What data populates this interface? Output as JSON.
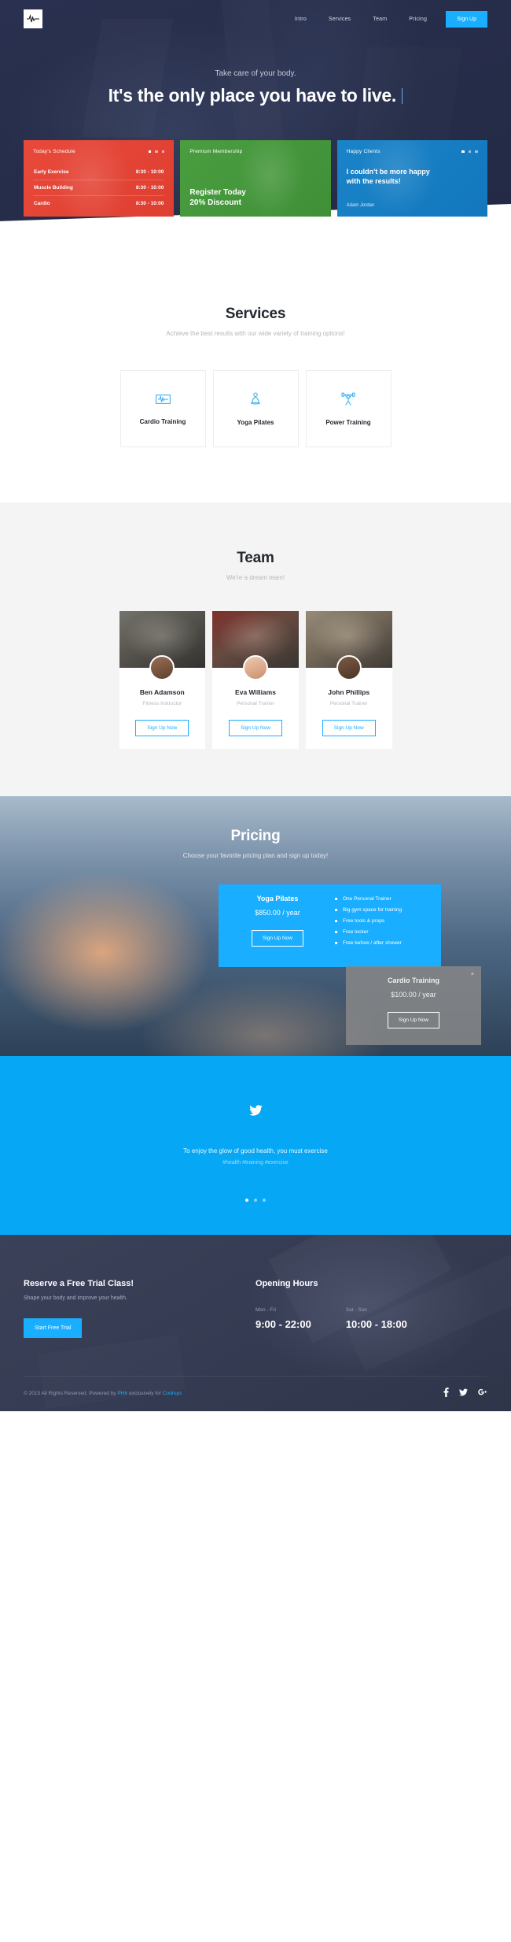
{
  "nav": {
    "logo_icon": "heartbeat-logo-icon",
    "links": [
      {
        "label": "Intro"
      },
      {
        "label": "Services"
      },
      {
        "label": "Team"
      },
      {
        "label": "Pricing"
      }
    ],
    "signup_label": "Sign Up"
  },
  "hero": {
    "subtitle": "Take care of your body.",
    "title": "It's the only place you have to live."
  },
  "promos": {
    "schedule": {
      "heading": "Today's Schedule",
      "rows": [
        {
          "name": "Early Exercise",
          "time": "8:30 - 10:00"
        },
        {
          "name": "Muscle Building",
          "time": "8:30 - 10:00"
        },
        {
          "name": "Cardio",
          "time": "8:30 - 10:00"
        }
      ]
    },
    "membership": {
      "heading": "Premium Membership",
      "line1": "Register Today",
      "line2": "20% Discount"
    },
    "clients": {
      "heading": "Happy Clients",
      "quote_line1": "I couldn't be more happy",
      "quote_line2": "with the results!",
      "author": "Adam Jordan"
    }
  },
  "services": {
    "title": "Services",
    "subtitle": "Achieve the best results with our wide variety of training options!",
    "items": [
      {
        "label": "Cardio Training",
        "icon": "heartbeat-monitor-icon"
      },
      {
        "label": "Yoga Pilates",
        "icon": "yoga-pose-icon"
      },
      {
        "label": "Power Training",
        "icon": "weightlifter-icon"
      }
    ]
  },
  "team": {
    "title": "Team",
    "subtitle": "We're a dream team!",
    "members": [
      {
        "name": "Ben Adamson",
        "role": "Fitness Instructor",
        "button": "Sign Up Now"
      },
      {
        "name": "Eva Williams",
        "role": "Personal Trainer",
        "button": "Sign Up Now"
      },
      {
        "name": "John Phillips",
        "role": "Personal Trainer",
        "button": "Sign Up Now"
      }
    ]
  },
  "pricing": {
    "title": "Pricing",
    "subtitle": "Choose your favorite pricing plan and sign up today!",
    "plans": [
      {
        "name": "Yoga Pilates",
        "price": "$850.00 / year",
        "button": "Sign Up Now",
        "features": [
          "One Personal Trainer",
          "Big gym space for training",
          "Free tools & props",
          "Free locker",
          "Free before / after shower"
        ]
      },
      {
        "name": "Cardio Training",
        "price": "$100.00 / year",
        "button": "Sign Up Now",
        "close": "×"
      }
    ]
  },
  "tweet": {
    "icon": "twitter-bird-icon",
    "text": "To enjoy the glow of good health, you must exercise",
    "tags": "#health #training #exercise"
  },
  "footer": {
    "cta": {
      "title": "Reserve a Free Trial Class!",
      "subtitle": "Shape your body and improve your health.",
      "button": "Start Free Trial"
    },
    "hours": {
      "title": "Opening Hours",
      "entries": [
        {
          "label": "Mon - Fri",
          "value": "9:00 - 22:00"
        },
        {
          "label": "Sat - Sun",
          "value": "10:00 - 18:00"
        }
      ]
    },
    "copyright_pre": "© 2015 All Rights Reserved. Powered by ",
    "copyright_link1": "PHIr",
    "copyright_mid": " exclusively for ",
    "copyright_link2": "Codrops",
    "socials": [
      {
        "icon": "facebook-icon",
        "glyph": "f"
      },
      {
        "icon": "twitter-icon",
        "glyph": "🐦"
      },
      {
        "icon": "google-plus-icon",
        "glyph": "g+"
      }
    ]
  },
  "colors": {
    "accent": "#19aeff",
    "tweet_bg": "#06a7f5",
    "dark": "#2a3150",
    "red": "#e8493a",
    "green": "#4a9e3f",
    "blue": "#1a84c9"
  }
}
